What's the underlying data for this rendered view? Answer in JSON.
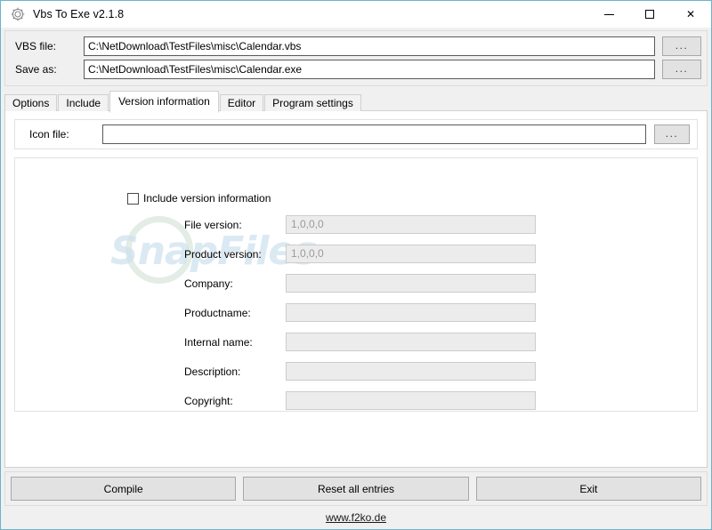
{
  "window": {
    "title": "Vbs To Exe v2.1.8",
    "icon": "gear-icon",
    "controls": {
      "minimize": "–",
      "maximize": "□",
      "close": "✕"
    },
    "accent_border": "#6bb3c7"
  },
  "file_panel": {
    "rows": [
      {
        "label": "VBS file:",
        "value": "C:\\NetDownload\\TestFiles\\misc\\Calendar.vbs",
        "browse_label": "..."
      },
      {
        "label": "Save as:",
        "value": "C:\\NetDownload\\TestFiles\\misc\\Calendar.exe",
        "browse_label": "..."
      }
    ]
  },
  "tabs": [
    {
      "label": "Options",
      "active": false
    },
    {
      "label": "Include",
      "active": false
    },
    {
      "label": "Version information",
      "active": true
    },
    {
      "label": "Editor",
      "active": false
    },
    {
      "label": "Program settings",
      "active": false
    }
  ],
  "version_tab": {
    "icon_file": {
      "label": "Icon file:",
      "value": "",
      "browse_label": "..."
    },
    "include_checkbox": {
      "label": "Include version information",
      "checked": false
    },
    "fields": [
      {
        "label": "File version:",
        "value": "1,0,0,0"
      },
      {
        "label": "Product version:",
        "value": "1,0,0,0"
      },
      {
        "label": "Company:",
        "value": ""
      },
      {
        "label": "Productname:",
        "value": ""
      },
      {
        "label": "Internal name:",
        "value": ""
      },
      {
        "label": "Description:",
        "value": ""
      },
      {
        "label": "Copyright:",
        "value": ""
      }
    ],
    "watermark": "SnapFiles"
  },
  "bottom": {
    "buttons": [
      {
        "label": "Compile"
      },
      {
        "label": "Reset all entries"
      },
      {
        "label": "Exit"
      }
    ],
    "footer_link": "www.f2ko.de"
  }
}
